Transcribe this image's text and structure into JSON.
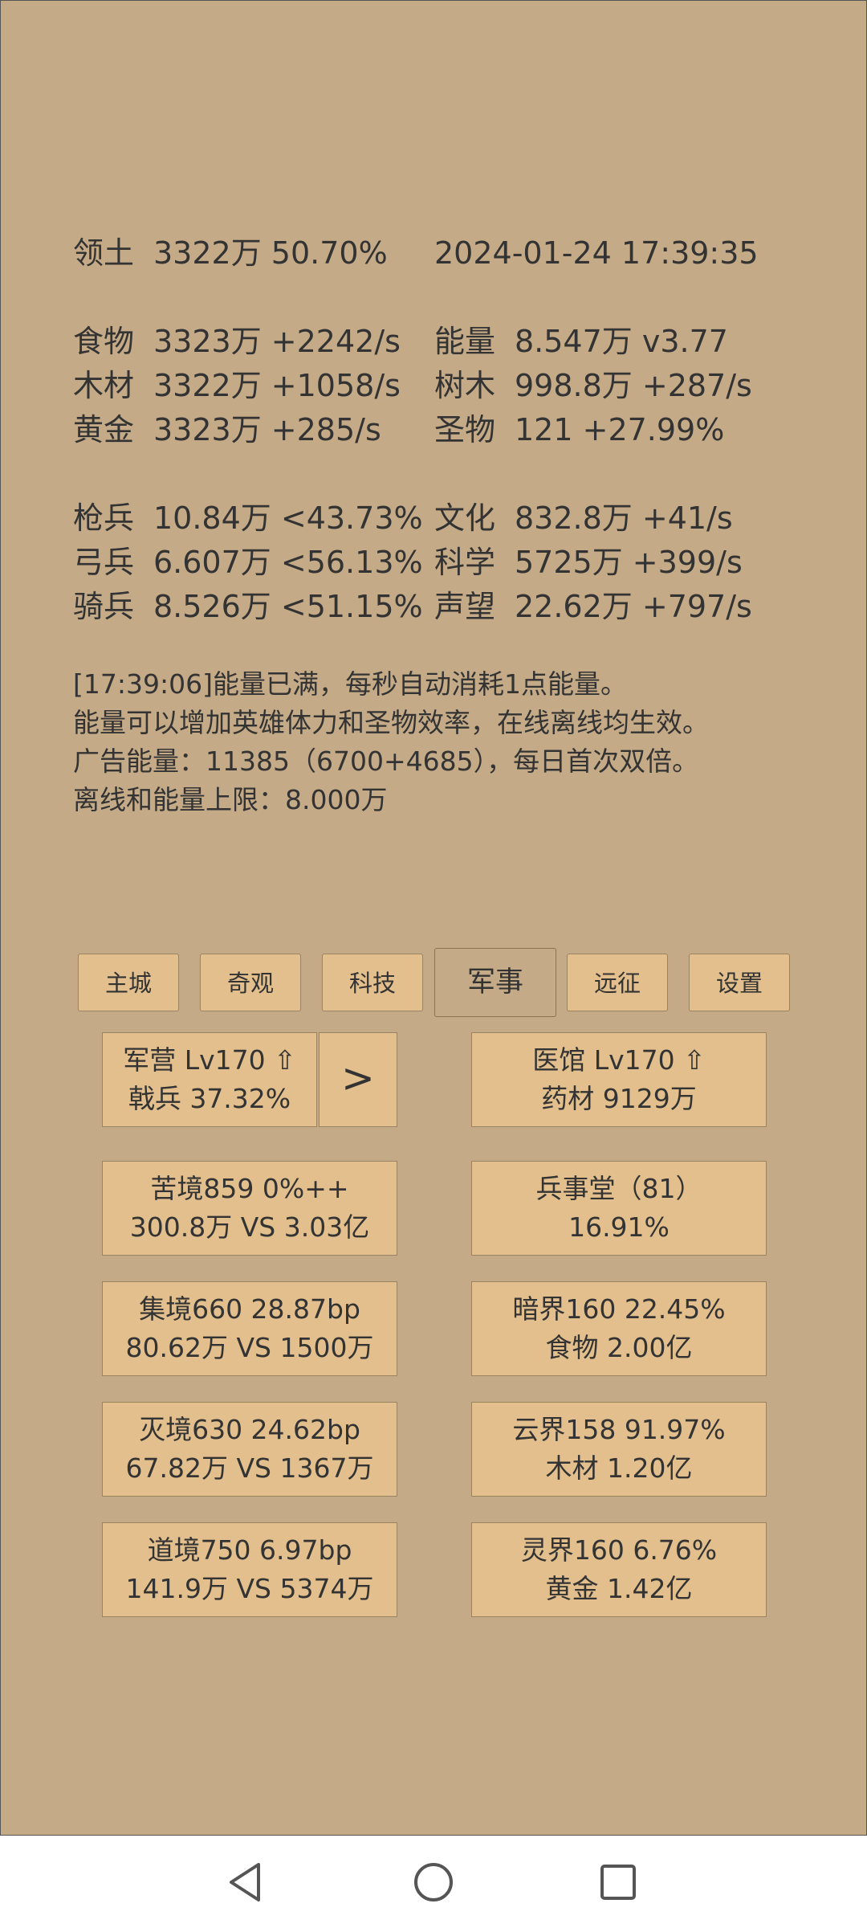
{
  "stats": {
    "territory": {
      "label": "领土",
      "value": "3322万  50.70%"
    },
    "datetime": "2024-01-24 17:39:35",
    "resources_left": [
      {
        "label": "食物",
        "value": "3323万 +2242/s"
      },
      {
        "label": "木材",
        "value": "3322万 +1058/s"
      },
      {
        "label": "黄金",
        "value": "3323万 +285/s"
      }
    ],
    "resources_right": [
      {
        "label": "能量",
        "value": "8.547万  v3.77"
      },
      {
        "label": "树木",
        "value": "998.8万 +287/s"
      },
      {
        "label": "圣物",
        "value": "121 +27.99%"
      }
    ],
    "troops_left": [
      {
        "label": "枪兵",
        "value": "10.84万 <43.73%"
      },
      {
        "label": "弓兵",
        "value": "6.607万 <56.13%"
      },
      {
        "label": "骑兵",
        "value": "8.526万 <51.15%"
      }
    ],
    "troops_right": [
      {
        "label": "文化",
        "value": "832.8万 +41/s"
      },
      {
        "label": "科学",
        "value": "5725万 +399/s"
      },
      {
        "label": "声望",
        "value": "22.62万 +797/s"
      }
    ]
  },
  "messages": [
    "[17:39:06]能量已满，每秒自动消耗1点能量。",
    "能量可以增加英雄体力和圣物效率，在线离线均生效。",
    "广告能量：11385（6700+4685），每日首次双倍。",
    "离线和能量上限：8.000万"
  ],
  "tabs": [
    {
      "label": "主城",
      "active": false
    },
    {
      "label": "奇观",
      "active": false
    },
    {
      "label": "科技",
      "active": false
    },
    {
      "label": "军事",
      "active": true
    },
    {
      "label": "远征",
      "active": false
    },
    {
      "label": "设置",
      "active": false
    }
  ],
  "military": {
    "barracks": {
      "line1": "军营 Lv170 ⇧",
      "line2": "戟兵 37.32%"
    },
    "next_label": ">",
    "hospital": {
      "line1": "医馆 Lv170 ⇧",
      "line2": "药材 9129万"
    },
    "left_cards": [
      {
        "line1": "苦境859  0%++",
        "line2": "300.8万 VS 3.03亿"
      },
      {
        "line1": "集境660  28.87bp",
        "line2": "80.62万 VS 1500万"
      },
      {
        "line1": "灭境630  24.62bp",
        "line2": "67.82万 VS 1367万"
      },
      {
        "line1": "道境750  6.97bp",
        "line2": "141.9万 VS 5374万"
      }
    ],
    "right_cards": [
      {
        "line1": "兵事堂（81）",
        "line2": "16.91%"
      },
      {
        "line1": "暗界160  22.45%",
        "line2": "食物 2.00亿"
      },
      {
        "line1": "云界158  91.97%",
        "line2": "木材 1.20亿"
      },
      {
        "line1": "灵界160  6.76%",
        "line2": "黄金 1.42亿"
      }
    ]
  },
  "navbar": {
    "icons": [
      "back-icon",
      "home-icon",
      "recents-icon"
    ]
  },
  "colors": {
    "background": "#c4aa87",
    "button": "#e2bf8c",
    "text": "#333333"
  }
}
